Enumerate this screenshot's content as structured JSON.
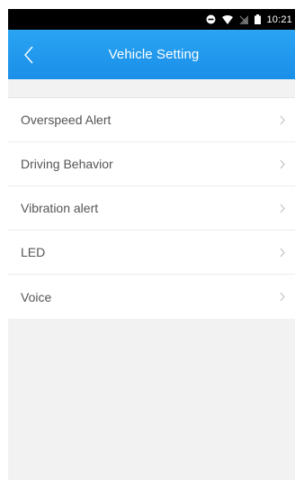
{
  "status_bar": {
    "time": "10:21",
    "icons": [
      "do-not-disturb-icon",
      "wifi-icon",
      "no-signal-icon",
      "battery-icon"
    ]
  },
  "header": {
    "title": "Vehicle Setting",
    "back_icon": "chevron-left-icon",
    "background": "#1f97ee"
  },
  "menu": {
    "items": [
      {
        "label": "Overspeed Alert"
      },
      {
        "label": "Driving Behavior"
      },
      {
        "label": "Vibration alert"
      },
      {
        "label": "LED"
      },
      {
        "label": "Voice"
      }
    ],
    "chevron_icon": "chevron-right-icon"
  }
}
